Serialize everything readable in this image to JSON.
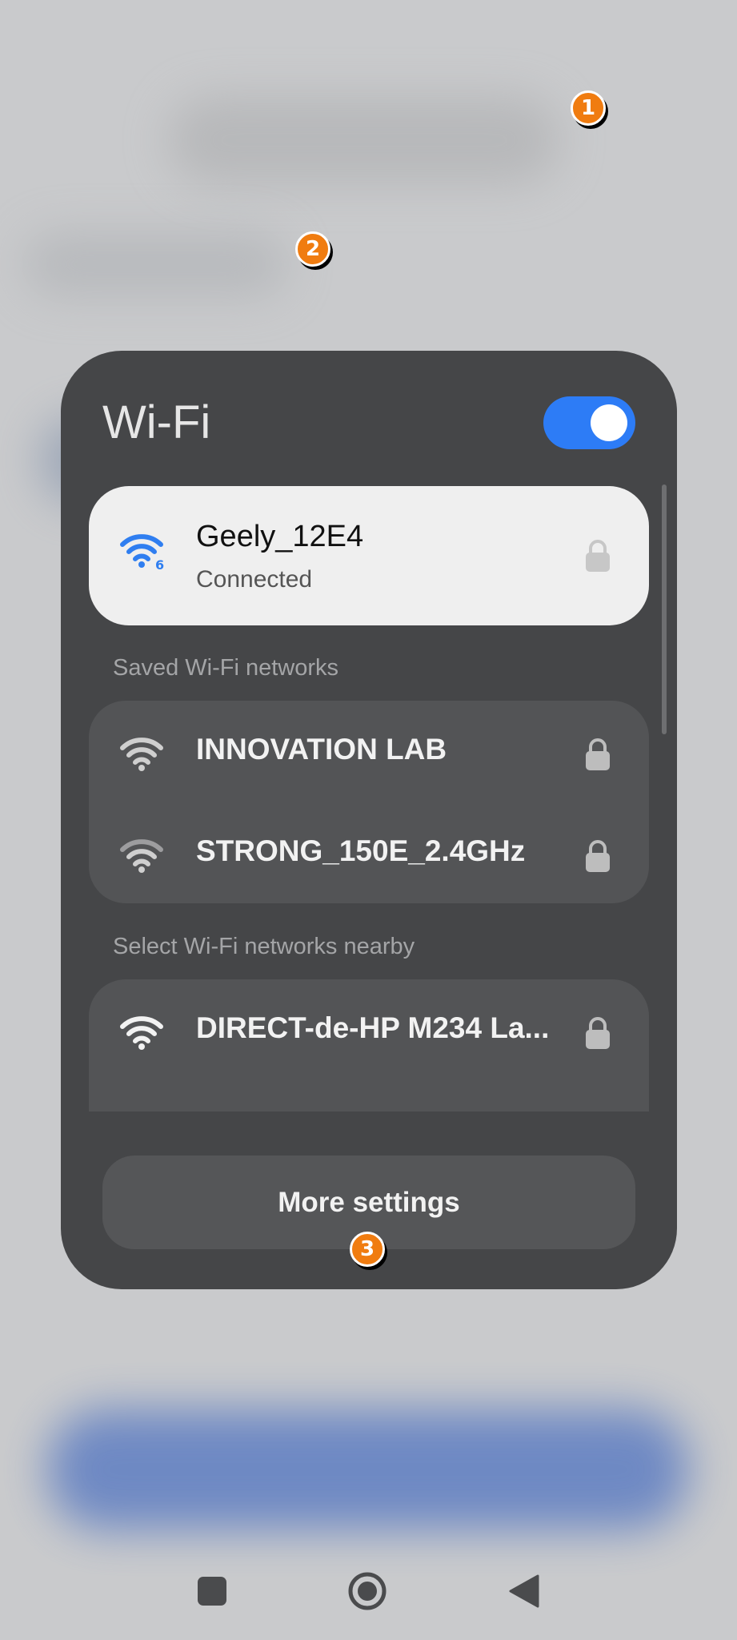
{
  "markers": [
    "1",
    "2",
    "3"
  ],
  "wifi_panel": {
    "title": "Wi-Fi",
    "toggle_on": true,
    "connected": {
      "name": "Geely_12E4",
      "status": "Connected",
      "icon": "wifi-6-icon",
      "secured": true
    },
    "saved_label": "Saved Wi-Fi networks",
    "saved_networks": [
      {
        "name": "INNOVATION LAB",
        "icon": "wifi-icon",
        "secured": true
      },
      {
        "name": "STRONG_150E_2.4GHz",
        "icon": "wifi-icon",
        "secured": true
      }
    ],
    "nearby_label": "Select Wi-Fi networks nearby",
    "nearby_networks": [
      {
        "name": "DIRECT-de-HP M234 La...",
        "icon": "wifi-icon",
        "secured": true
      }
    ],
    "more_settings_label": "More settings"
  },
  "colors": {
    "accent": "#2d7cf6",
    "marker": "#f07c10",
    "panel": "#454648"
  },
  "nav_bar": [
    "recent-apps-icon",
    "home-icon",
    "back-icon"
  ]
}
